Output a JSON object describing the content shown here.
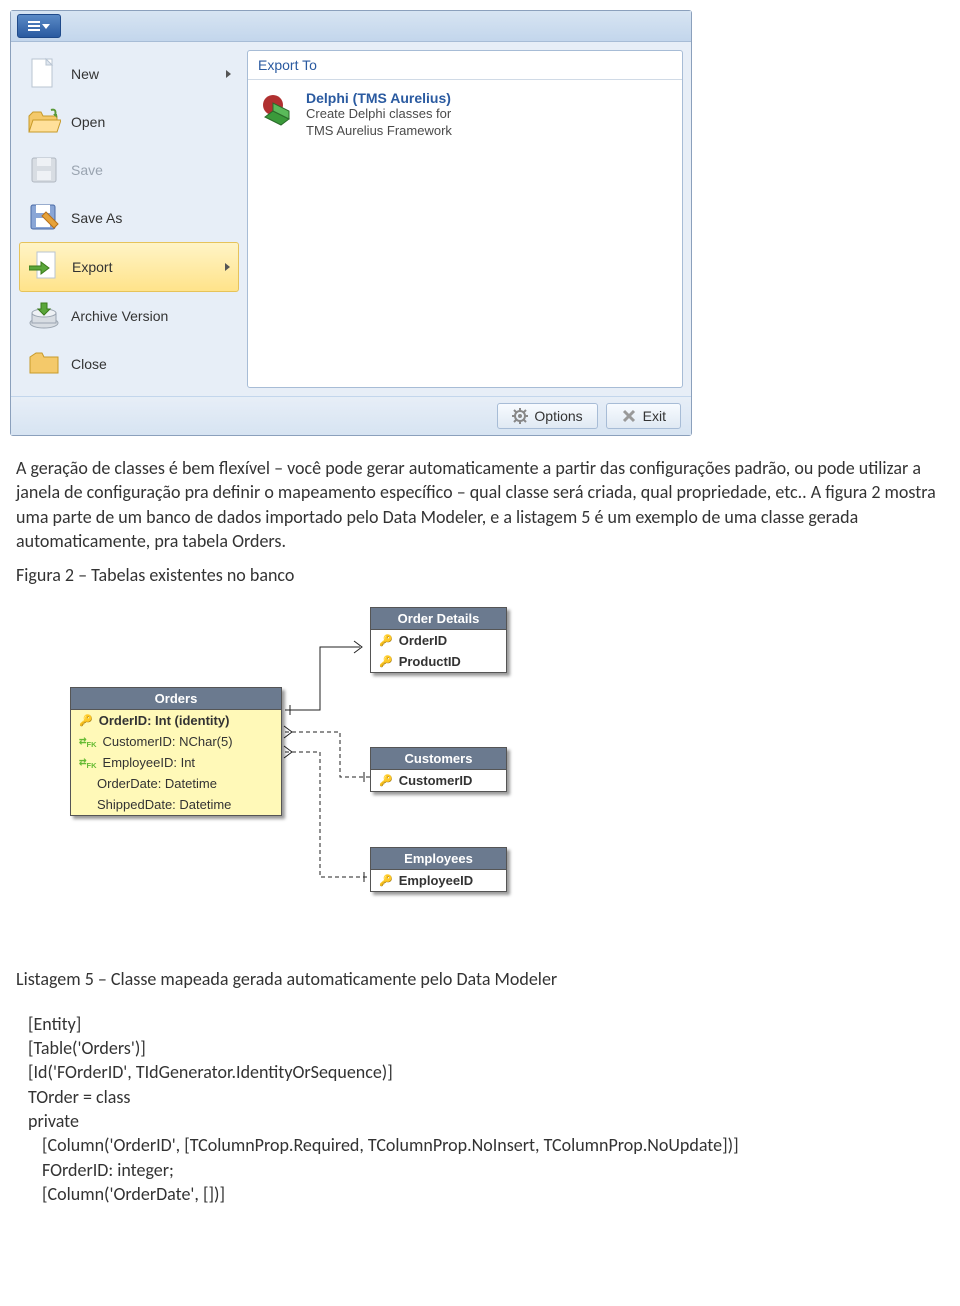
{
  "dialog": {
    "menu": {
      "new": "New",
      "open": "Open",
      "save": "Save",
      "saveas": "Save As",
      "export": "Export",
      "archive": "Archive Version",
      "close": "Close"
    },
    "rightHeader": "Export To",
    "exportOption": {
      "title": "Delphi (TMS Aurelius)",
      "desc1": "Create Delphi classes for",
      "desc2": "TMS Aurelius Framework"
    },
    "footer": {
      "options": "Options",
      "exit": "Exit"
    }
  },
  "para1": "A geração de classes é bem flexível – você pode gerar automaticamente a partir das configurações padrão, ou pode utilizar a janela de configuração pra definir o mapeamento específico – qual classe será criada, qual propriedade, etc.. A figura 2 mostra uma parte de um banco de dados importado pelo Data Modeler, e a listagem 5 é um exemplo de uma classe gerada automaticamente, pra tabela Orders.",
  "figcap": "Figura 2 – Tabelas existentes no banco",
  "er": {
    "orders": {
      "title": "Orders",
      "r1": "OrderID: Int (identity)",
      "r2": "CustomerID: NChar(5)",
      "r3": "EmployeeID: Int",
      "r4": "OrderDate: Datetime",
      "r5": "ShippedDate: Datetime"
    },
    "orderdetails": {
      "title": "Order Details",
      "r1": "OrderID",
      "r2": "ProductID"
    },
    "customers": {
      "title": "Customers",
      "r1": "CustomerID"
    },
    "employees": {
      "title": "Employees",
      "r1": "EmployeeID"
    }
  },
  "listingcap": "Listagem 5 – Classe mapeada gerada automaticamente pelo Data Modeler",
  "code": {
    "l1": "[Entity]",
    "l2": "[Table('Orders')]",
    "l3": "[Id('FOrderID', TIdGenerator.IdentityOrSequence)]",
    "l4": "TOrder = class",
    "l5": "private",
    "l6": "[Column('OrderID', [TColumnProp.Required, TColumnProp.NoInsert, TColumnProp.NoUpdate])]",
    "l7": "FOrderID: integer;",
    "l8": "[Column('OrderDate', [])]"
  }
}
